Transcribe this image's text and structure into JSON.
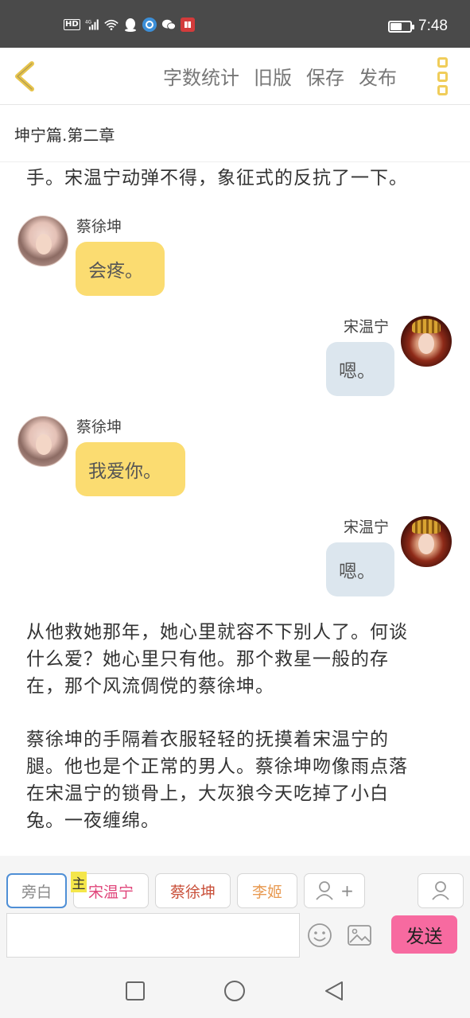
{
  "status_bar": {
    "network_badge": "HD",
    "signal_label": "4G",
    "time": "7:48",
    "battery_level": 0.55,
    "icons": [
      "hd-icon",
      "signal-icon",
      "wifi-icon",
      "qq-icon",
      "app-icon",
      "wechat-icon",
      "reader-icon"
    ]
  },
  "toolbar": {
    "back_icon": "chevron-left-icon",
    "word_count_label": "字数统计",
    "old_version_label": "旧版",
    "save_label": "保存",
    "publish_label": "发布",
    "menu_icon": "vertical-dots-icon"
  },
  "chapter_title": "坤宁篇.第二章",
  "content": {
    "top_narration": "手。宋温宁动弹不得，象征式的反抗了一下。",
    "messages": [
      {
        "speaker": "蔡徐坤",
        "text": "会疼。",
        "side": "left"
      },
      {
        "speaker": "宋温宁",
        "text": "嗯。",
        "side": "right"
      },
      {
        "speaker": "蔡徐坤",
        "text": "我爱你。",
        "side": "left"
      },
      {
        "speaker": "宋温宁",
        "text": "嗯。",
        "side": "right"
      }
    ],
    "narration_1": [
      "从他救她那年，她心里就容不下别人了。何谈",
      "什么爱？她心里只有他。那个救星一般的存",
      "在，那个风流倜傥的蔡徐坤。"
    ],
    "narration_2": [
      "蔡徐坤的手隔着衣服轻轻的抚摸着宋温宁的",
      "腿。他也是个正常的男人。蔡徐坤吻像雨点落",
      "在宋温宁的锁骨上，大灰狼今天吃掉了小白",
      "兔。一夜缠绵。"
    ]
  },
  "characters": {
    "narrator_label": "旁白",
    "main_tag": "主",
    "chars": [
      {
        "name": "宋温宁",
        "color": "#e0457a"
      },
      {
        "name": "蔡徐坤",
        "color": "#c9503a"
      },
      {
        "name": "李姬",
        "color": "#e89a52"
      }
    ],
    "add_label": "+",
    "input_placeholder": "",
    "send_label": "发送"
  },
  "colors": {
    "accent_yellow": "#f0cd5a",
    "bubble_left": "#fbdc71",
    "bubble_right": "#dce6ee",
    "send_button": "#f76aa0",
    "active_border": "#4f8fd6"
  }
}
